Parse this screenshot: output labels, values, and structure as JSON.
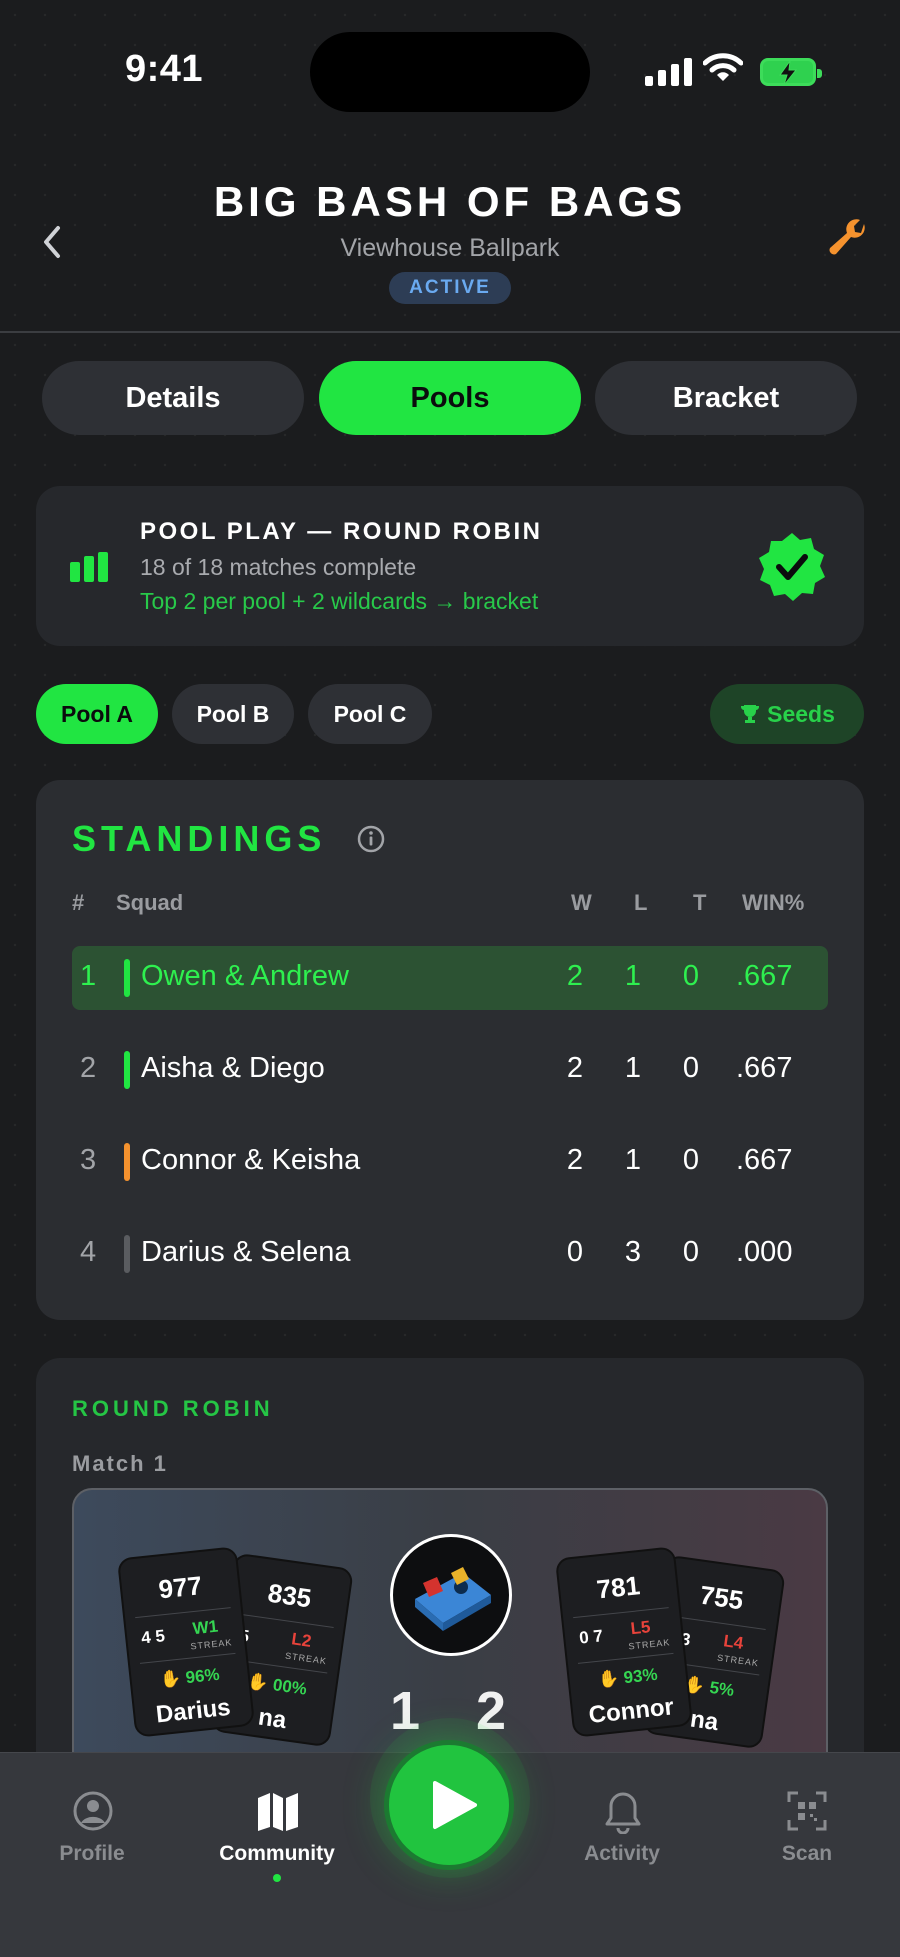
{
  "status_bar": {
    "time": "9:41"
  },
  "header": {
    "title": "BIG BASH OF BAGS",
    "subtitle": "Viewhouse Ballpark",
    "badge": "ACTIVE"
  },
  "segments": [
    {
      "label": "Details",
      "active": false
    },
    {
      "label": "Pools",
      "active": true
    },
    {
      "label": "Bracket",
      "active": false
    }
  ],
  "pool_play": {
    "title": "POOL PLAY — ROUND ROBIN",
    "progress_text": "18 of 18 matches complete",
    "note": "Top 2 per pool + 2 wildcards → bracket"
  },
  "pools": [
    {
      "label": "Pool A",
      "active": true
    },
    {
      "label": "Pool B",
      "active": false
    },
    {
      "label": "Pool C",
      "active": false
    }
  ],
  "seeds_label": "Seeds",
  "standings": {
    "title": "STANDINGS",
    "columns": {
      "rank": "#",
      "squad": "Squad",
      "w": "W",
      "l": "L",
      "t": "T",
      "pct": "WIN%"
    },
    "rows": [
      {
        "rank": "1",
        "squad": "Owen & Andrew",
        "w": "2",
        "l": "1",
        "t": "0",
        "pct": ".667",
        "marker": "#21e542"
      },
      {
        "rank": "2",
        "squad": "Aisha & Diego",
        "w": "2",
        "l": "1",
        "t": "0",
        "pct": ".667",
        "marker": "#21e542"
      },
      {
        "rank": "3",
        "squad": "Connor & Keisha",
        "w": "2",
        "l": "1",
        "t": "0",
        "pct": ".667",
        "marker": "#f5922e"
      },
      {
        "rank": "4",
        "squad": "Darius & Selena",
        "w": "0",
        "l": "3",
        "t": "0",
        "pct": ".000",
        "marker": "#5a5c60"
      }
    ]
  },
  "round_robin": {
    "title": "ROUND ROBIN",
    "match_label": "Match 1",
    "left_cards": [
      {
        "rating": "835",
        "w": "5",
        "l": "",
        "streak": "L2",
        "streak_color": "#e8433b",
        "pct": "00%",
        "name": "na"
      },
      {
        "rating": "977",
        "w": "4",
        "l": "5",
        "streak": "W1",
        "streak_color": "#35d552",
        "pct": "96%",
        "name": "Darius"
      }
    ],
    "right_cards": [
      {
        "rating": "755",
        "w": "13",
        "l": "",
        "streak": "L4",
        "streak_color": "#e8433b",
        "pct": "5%",
        "name": "na"
      },
      {
        "rating": "781",
        "w": "0",
        "l": "7",
        "streak": "L5",
        "streak_color": "#e8433b",
        "pct": "93%",
        "name": "Connor"
      }
    ],
    "streak_label": "STREAK",
    "w_label": "W",
    "l_label": "L",
    "score_left": "1",
    "score_right": "2"
  },
  "tab_bar": [
    {
      "label": "Profile",
      "icon": "profile-icon",
      "active": false
    },
    {
      "label": "Community",
      "icon": "map-icon",
      "active": true
    },
    {
      "label": "Activity",
      "icon": "bell-icon",
      "active": false
    },
    {
      "label": "Scan",
      "icon": "qr-scan-icon",
      "active": false
    }
  ],
  "colors": {
    "accent": "#21e542",
    "background": "#1b1c1e",
    "badge_text": "#6aaaf0",
    "warning": "#f5922e",
    "loss": "#e8433b"
  }
}
